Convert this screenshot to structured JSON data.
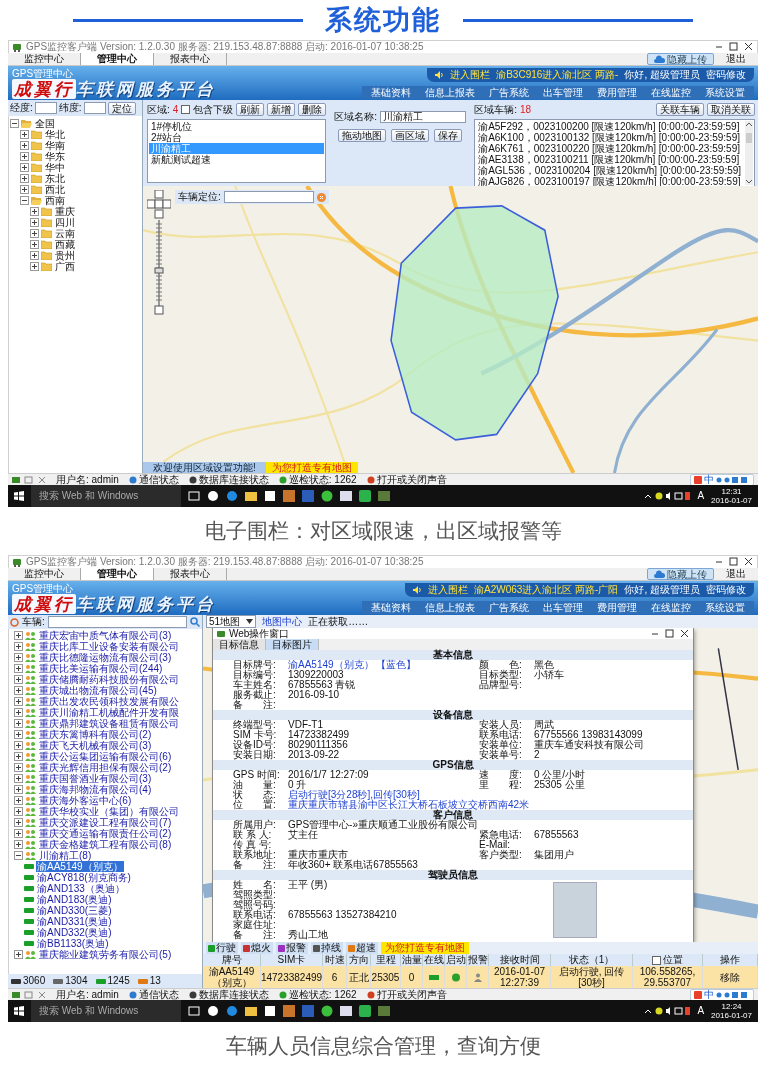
{
  "heading": "系统功能",
  "screens": [
    {
      "kind": "fence",
      "window": {
        "title": "GPS监控客户端  Version: 1.2.0.30  服务器: 219.153.48.87:8888  启动: 2016-01-07 10:38:25"
      },
      "menu": [
        {
          "label": "监控中心",
          "selected": false
        },
        {
          "label": "管理中心",
          "selected": true
        },
        {
          "label": "报表中心",
          "selected": false
        }
      ],
      "top_right": {
        "button": "隐藏上传",
        "exit": "退出"
      },
      "banner": {
        "subtitle": "GPS管理中心",
        "logo_accent": "成翼行",
        "logo_rest": "车联网服务平台",
        "alert_tag": "进入围栏",
        "alert": "渝B3C916进入渝北区 两路-",
        "greeting": "你好, 超级管理员",
        "password": "密码修改",
        "nav": [
          "基础资料",
          "信息上报表",
          "广告系统",
          "出车管理",
          "费用管理",
          "在线监控",
          "系统设置"
        ]
      },
      "fence": {
        "lon_label": "经度:",
        "lat_label": "纬度:",
        "locate": "定位",
        "tree": [
          {
            "label": "全国",
            "expanded": true,
            "children": [
              {
                "label": "华北",
                "expanded": false
              },
              {
                "label": "华南",
                "expanded": false
              },
              {
                "label": "华东",
                "expanded": false
              },
              {
                "label": "华中",
                "expanded": false
              },
              {
                "label": "东北",
                "expanded": false
              },
              {
                "label": "西北",
                "expanded": false
              },
              {
                "label": "西南",
                "expanded": true,
                "children": [
                  {
                    "label": "重庆",
                    "expanded": false
                  },
                  {
                    "label": "四川",
                    "expanded": false
                  },
                  {
                    "label": "云南",
                    "expanded": false
                  },
                  {
                    "label": "西藏",
                    "expanded": false
                  },
                  {
                    "label": "贵州",
                    "expanded": false
                  },
                  {
                    "label": "广西",
                    "expanded": false
                  }
                ]
              }
            ]
          }
        ],
        "area_label": "区域:",
        "area_count": "4",
        "include_label": "包含下级",
        "include_checked": false,
        "buttons": [
          "刷新",
          "新增",
          "删除"
        ],
        "areas": [
          {
            "label": "1#停机位",
            "selected": false
          },
          {
            "label": "2#站台",
            "selected": false
          },
          {
            "label": "川渝精工",
            "selected": true
          },
          {
            "label": "新航测试超速",
            "selected": false
          }
        ],
        "name_label": "区域名称:",
        "name_value": "川渝精工",
        "actions": [
          "拖动地图",
          "画区域",
          "保存"
        ],
        "vehicles_label": "区域车辆:",
        "vehicles_count": "18",
        "vehicle_buttons": [
          "关联车辆",
          "取消关联"
        ],
        "vehicles": [
          "渝A5F292，0023100200 [限速120km/h] [0:00:00-23:59:59]",
          "渝A6K100，0023100132 [限速120km/h] [0:00:00-23:59:59]",
          "渝A6K761，0023100220 [限速120km/h] [0:00:00-23:59:59]",
          "渝AE3138，0023100211 [限速120km/h] [0:00:00-23:59:59]",
          "渝AGL536，0023100204 [限速120km/h] [0:00:00-23:59:59]",
          "渝AJG826，0023100197 [限速120km/h] [0:00:00-23:59:59]"
        ],
        "locate_label": "车辆定位:",
        "notice": "欢迎使用区域设置功能!",
        "promo": "为您打造专有地图"
      },
      "status_bar": [
        "用户名: admin",
        "通信状态",
        "数据库连接状态",
        "巡检状态: 1262",
        "打开或关闭声音"
      ],
      "ime_bar": "中",
      "taskbar": {
        "search": "搜索 Web 和 Windows",
        "ime": "A",
        "time": "12:31",
        "date": "2016-01-07"
      },
      "caption": "电子围栏：对区域限速，出区域报警等"
    },
    {
      "kind": "info",
      "window": {
        "title": "GPS监控客户端  Version: 1.2.0.30  服务器: 219.153.48.87:8888  启动: 2016-01-07 10:38:25"
      },
      "menu": [
        {
          "label": "监控中心",
          "selected": false
        },
        {
          "label": "管理中心",
          "selected": true
        },
        {
          "label": "报表中心",
          "selected": false
        }
      ],
      "top_right": {
        "button": "隐藏上传",
        "exit": "退出"
      },
      "banner": {
        "subtitle": "GPS管理中心",
        "logo_accent": "成翼行",
        "logo_rest": "车联网服务平台",
        "alert_tag": "进入围栏",
        "alert": "渝A2W063进入渝北区 两路-广阳",
        "greeting": "你好, 超级管理员",
        "password": "密码修改",
        "nav": [
          "基础资料",
          "信息上报表",
          "广告系统",
          "出车管理",
          "费用管理",
          "在线监控",
          "系统设置"
        ]
      },
      "vehicles_panel": {
        "label": "车辆:",
        "tree": [
          {
            "label": "重庆宏宙中质气体有限公司(3)",
            "expanded": false
          },
          {
            "label": "重庆比库工业设备安装有限公司",
            "expanded": false
          },
          {
            "label": "重庆比德隆运物流有限公司(3)",
            "expanded": false
          },
          {
            "label": "重庆比美运输有限公司(244)",
            "expanded": false
          },
          {
            "label": "重庆储腾耐药科技股份有限公司",
            "expanded": false
          },
          {
            "label": "重庆城出物流有限公司(45)",
            "expanded": false
          },
          {
            "label": "重庆出发农民领科技发展有限公",
            "expanded": false
          },
          {
            "label": "重庆川渝精工机械配件开发有限",
            "expanded": false
          },
          {
            "label": "重庆鼎邦建筑设备租赁有限公司",
            "expanded": false
          },
          {
            "label": "重庆东篱博科有限公司(2)",
            "expanded": false
          },
          {
            "label": "重庆飞天机械有限公司(3)",
            "expanded": false
          },
          {
            "label": "重庆公运集团运输有限公司(6)",
            "expanded": false
          },
          {
            "label": "重庆光辉信用担保有限公司(2)",
            "expanded": false
          },
          {
            "label": "重庆国誉酒业有限公司(3)",
            "expanded": false
          },
          {
            "label": "重庆海邦物流有限公司(4)",
            "expanded": false
          },
          {
            "label": "重庆海外客运中心(6)",
            "expanded": false
          },
          {
            "label": "重庆华校实业（集团）有限公司",
            "expanded": false
          },
          {
            "label": "重庆交派建设工程有限公司(7)",
            "expanded": false
          },
          {
            "label": "重庆交通运输有限责任公司(2)",
            "expanded": false
          },
          {
            "label": "重庆金格建筑工程有限公司(8)",
            "expanded": false
          },
          {
            "label": "川渝精工(8)",
            "expanded": true,
            "children": [
              {
                "label": "渝AA5149（别克）",
                "selected": true
              },
              {
                "label": "渝ACY818(别克商务)",
                "selected": false
              },
              {
                "label": "渝AND133（奥迪）",
                "selected": false
              },
              {
                "label": "渝AND183(奥迪)",
                "selected": false
              },
              {
                "label": "渝AND330(三菱)",
                "selected": false
              },
              {
                "label": "渝AND331(奥迪)",
                "selected": false
              },
              {
                "label": "渝AND332(奥迪)",
                "selected": false
              },
              {
                "label": "渝BB1133(奥迪)",
                "selected": false
              }
            ]
          },
          {
            "label": "重庆能业建筑劳务有限公司(5)",
            "expanded": false
          }
        ],
        "counts": [
          "3060",
          "1304",
          "1245",
          "13"
        ]
      },
      "map_toolbar": {
        "map_select": "51地图",
        "map_center": "地图中心",
        "map_status": "正在获取……"
      },
      "dialog": {
        "title": "Web操作窗口",
        "tabs": [
          {
            "label": "目标信息",
            "selected": false
          },
          {
            "label": "目标图片",
            "selected": true
          }
        ],
        "sections": [
          {
            "title": "基本信息",
            "kind": "fields",
            "rows": [
              {
                "left": {
                  "label": "目标牌号:",
                  "value": "渝AA5149（别克） 【蓝色】",
                  "link": true
                },
                "right": {
                  "label": "颜　　色:",
                  "value": "黑色"
                }
              },
              {
                "left": {
                  "label": "目标编号:",
                  "value": "1309220003"
                },
                "right": {
                  "label": "目标类型:",
                  "value": "小轿车"
                }
              },
              {
                "left": {
                  "label": "车主姓名:",
                  "value": "67855563 青锐"
                },
                "right": {
                  "label": "品牌型号:"
                }
              },
              {
                "left": {
                  "label": "服务截止:",
                  "value": "2016-09-10"
                }
              },
              {
                "left": {
                  "label": "备　　注:"
                }
              }
            ]
          },
          {
            "title": "设备信息",
            "kind": "fields",
            "rows": [
              {
                "left": {
                  "label": "终端型号:",
                  "value": "VDF-T1"
                },
                "right": {
                  "label": "安装人员:",
                  "value": "周武"
                }
              },
              {
                "left": {
                  "label": "SIM 卡号:",
                  "value": "14723382499"
                },
                "right": {
                  "label": "联系电话:",
                  "value": "67755566 13983143099"
                }
              },
              {
                "left": {
                  "label": "设备ID号:",
                  "value": "80290111356"
                },
                "right": {
                  "label": "安装单位:",
                  "value": "重庆车通安科技有限公司"
                }
              },
              {
                "left": {
                  "label": "安装日期:",
                  "value": "2013-09-22"
                },
                "right": {
                  "label": "安装单号:",
                  "value": "2"
                }
              }
            ]
          },
          {
            "title": "GPS信息",
            "kind": "fields",
            "rows": [
              {
                "left": {
                  "label": "GPS 时间:",
                  "value": "2016/1/7 12:27:09"
                },
                "right": {
                  "label": "速　　度:",
                  "value": "0 公里/小时"
                }
              },
              {
                "left": {
                  "label": "油　　量:",
                  "value": "0 升"
                },
                "right": {
                  "label": "里　　程:",
                  "value": "25305 公里"
                }
              },
              {
                "left": {
                  "label": "状　　态:",
                  "value": "启动行驶[3分28秒],回传[30秒]",
                  "link": true
                }
              },
              {
                "left": {
                  "label": "位　　置:",
                  "value": "重庆重庆市辖县渝中区长江大桥石板坡立交桥西南42米",
                  "link": true
                }
              }
            ]
          },
          {
            "title": "客户信息",
            "kind": "fields",
            "rows": [
              {
                "left": {
                  "label": "所属用户:",
                  "value": "GPS管理中心-»重庆顺通工业股份有限公司"
                }
              },
              {
                "left": {
                  "label": "联 系 人:",
                  "value": "艾主任"
                },
                "right": {
                  "label": "紧急电话:",
                  "value": "67855563"
                }
              },
              {
                "left": {
                  "label": "传 真 号:"
                },
                "right": {
                  "label": "E-Mail:"
                }
              },
              {
                "left": {
                  "label": "联系地址:",
                  "value": "重庆市重庆市"
                },
                "right": {
                  "label": "客户类型:",
                  "value": "集团用户"
                }
              },
              {
                "left": {
                  "label": "备　　注:",
                  "value": "年收360+ 联系电话67855563"
                }
              }
            ]
          },
          {
            "title": "驾驶员信息",
            "kind": "driver",
            "rows": [
              {
                "left": {
                  "label": "姓　　名:",
                  "value": "王平 (男)"
                }
              },
              {
                "left": {
                  "label": "驾照类型:"
                }
              },
              {
                "left": {
                  "label": "驾照号码:"
                }
              },
              {
                "left": {
                  "label": "联系电话:",
                  "value": "67855563 13527384210"
                }
              },
              {
                "left": {
                  "label": "家庭住址:"
                }
              },
              {
                "left": {
                  "label": "备　　注:",
                  "value": "秀山工地"
                }
              }
            ]
          }
        ]
      },
      "legend": [
        {
          "label": "行驶",
          "color": "#1a9e2a"
        },
        {
          "label": "熄火",
          "color": "#c83232"
        },
        {
          "label": "报警",
          "color": "#9a2fc0"
        },
        {
          "label": "掉线",
          "color": "#555555"
        },
        {
          "label": "超速",
          "color": "#e07a10"
        }
      ],
      "legend_promo": "为您打造专有地图",
      "table": {
        "position_checked": false,
        "columns": [
          {
            "label": "牌号",
            "kind": "text"
          },
          {
            "label": "SIM卡",
            "kind": "text"
          },
          {
            "label": "时速",
            "kind": "text"
          },
          {
            "label": "方向",
            "kind": "text"
          },
          {
            "label": "里程",
            "kind": "text"
          },
          {
            "label": "油量",
            "kind": "text"
          },
          {
            "label": "在线",
            "kind": "icon"
          },
          {
            "label": "启动",
            "kind": "icon"
          },
          {
            "label": "报警",
            "kind": "icon"
          },
          {
            "label": "接收时间",
            "kind": "text"
          },
          {
            "label": "状态（1）",
            "kind": "text"
          },
          {
            "label": "位置",
            "kind": "text"
          },
          {
            "label": "操作",
            "kind": "text"
          }
        ],
        "rows": [
          {
            "selected": true,
            "cells": [
              "渝AA5149（别克）",
              "14723382499",
              "6",
              "正北",
              "25305",
              "0",
              "",
              "",
              "",
              "2016-01-07 12:27:39",
              "启动行驶, 回传[30秒]",
              "106.558265, 29.553707",
              "移除"
            ]
          }
        ]
      },
      "status_bar": [
        "用户名: admin",
        "通信状态",
        "数据库连接状态",
        "巡检状态: 1262",
        "打开或关闭声音"
      ],
      "ime_bar": "中",
      "taskbar": {
        "search": "搜索 Web 和 Windows",
        "ime": "A",
        "time": "12:24",
        "date": "2016-01-07"
      },
      "caption": "车辆人员信息综合管理，查询方便"
    }
  ]
}
